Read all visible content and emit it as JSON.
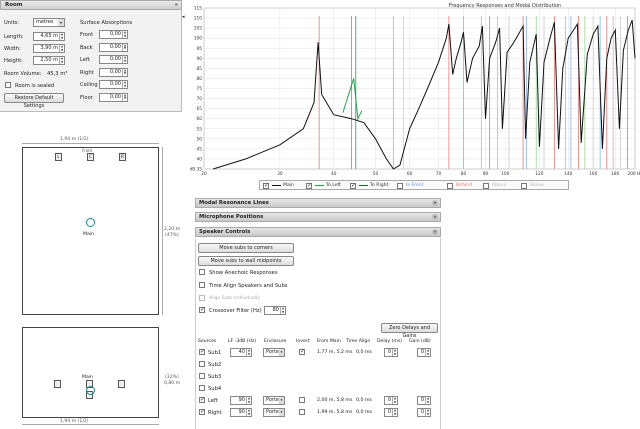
{
  "room": {
    "title": "Room",
    "units_label": "Units:",
    "units_value": "metres",
    "length_label": "Length:",
    "length_value": "4,65 m",
    "width_label": "Width:",
    "width_value": "3,90 m",
    "height_label": "Height:",
    "height_value": "2,50 m",
    "volume_label": "Room Volume:",
    "volume_value": "45,3 m³",
    "sealed_label": "Room is sealed",
    "restore_label": "Restore Default Settings",
    "surf_title": "Surface Absorptions",
    "surfaces": [
      {
        "label": "Front",
        "value": "0,00"
      },
      {
        "label": "Back",
        "value": "0,00"
      },
      {
        "label": "Left",
        "value": "0,00"
      },
      {
        "label": "Right",
        "value": "0,00"
      },
      {
        "label": "Ceiling",
        "value": "0,00"
      },
      {
        "label": "Floor",
        "value": "0,00"
      }
    ]
  },
  "plan": {
    "dim_top": "1,94 m (1/2)",
    "front_label": "Front",
    "spk_l": "L",
    "spk_c": "C",
    "spk_r": "R",
    "main": "Main",
    "dim_side": "2,20 m",
    "dim_side_pct": "(47%)"
  },
  "elev": {
    "main": "Main",
    "dim_side_pct": "(32%)",
    "dim_side": "0,80 m",
    "dim_bottom": "1,94 m (1/2)"
  },
  "chart_data": {
    "type": "line",
    "title": "Frequency Responses and Modal Distribution",
    "y_ticks": [
      "115",
      "110",
      "105",
      "100",
      "95",
      "90",
      "85",
      "80",
      "75",
      "70",
      "65",
      "60",
      "55",
      "50",
      "45",
      "40",
      "dB 35"
    ],
    "x_ticks": [
      "20",
      "30",
      "40",
      "50",
      "60",
      "70",
      "80",
      "90",
      "100",
      "120",
      "140",
      "160",
      "180",
      "200 Hz"
    ],
    "ylim": [
      35,
      115
    ],
    "xlim": [
      20,
      200
    ],
    "log_x": true,
    "series": [
      {
        "name": "Main",
        "color": "#111111"
      },
      {
        "name": "To Left",
        "color": "#2a9d50"
      },
      {
        "name": "To Right",
        "color": "#1a6a2a"
      }
    ],
    "mode_lines": {
      "front": "#8fb3e8",
      "behind": "#e07a7a",
      "above": "#c9c9c9",
      "below": "#d8a0d8"
    }
  },
  "legend": [
    {
      "label": "Main",
      "checked": true,
      "color": "#111"
    },
    {
      "label": "To Left",
      "checked": true,
      "color": "#2a9d50"
    },
    {
      "label": "To Right",
      "checked": true,
      "color": "#1a6a2a"
    },
    {
      "label": "In Front",
      "checked": false,
      "color": "#6a8fd8"
    },
    {
      "label": "Behind",
      "checked": false,
      "color": "#e07a7a"
    },
    {
      "label": "Above",
      "checked": false,
      "color": "#bbb"
    },
    {
      "label": "Below",
      "checked": false,
      "color": "#bbb"
    }
  ],
  "panels": {
    "modal": "Modal Resonance Lines",
    "mic": "Microphone Positions",
    "speaker": "Speaker Controls"
  },
  "sc": {
    "corners": "Move subs to corners",
    "midpoints": "Move subs to wall midpoints",
    "anechoic": "Show Anechoic Responses",
    "time_align": "Time Align Speakers and Subs",
    "align_subs": "Align Subs Individually",
    "crossover": "Crossover Filter (Hz)",
    "crossover_value": "80",
    "zero": "Zero Delays and Gains",
    "headers": [
      "Sources",
      "LF -3dB (Hz)",
      "Enclosure",
      "Invert",
      "From Main",
      "Time Align",
      "Delay (ms)",
      "Gain (dB)"
    ],
    "rows": [
      {
        "name": "Sub1",
        "checked": true,
        "lf": "40",
        "enc": "Ported",
        "inv": true,
        "from": "1,77 m, 5,2 ms",
        "ta": "0,0 ms",
        "delay": "0",
        "gain": "0"
      },
      {
        "name": "Sub2",
        "checked": false
      },
      {
        "name": "Sub3",
        "checked": false
      },
      {
        "name": "Sub4",
        "checked": false
      },
      {
        "name": "Left",
        "checked": true,
        "lf": "90",
        "enc": "Ported",
        "inv": false,
        "from": "2,00 m, 5,8 ms",
        "ta": "0,0 ms",
        "delay": "0",
        "gain": "0"
      },
      {
        "name": "Right",
        "checked": true,
        "lf": "90",
        "enc": "Ported",
        "inv": false,
        "from": "1,99 m, 5,8 ms",
        "ta": "0,0 ms",
        "delay": "0",
        "gain": "0"
      }
    ]
  }
}
